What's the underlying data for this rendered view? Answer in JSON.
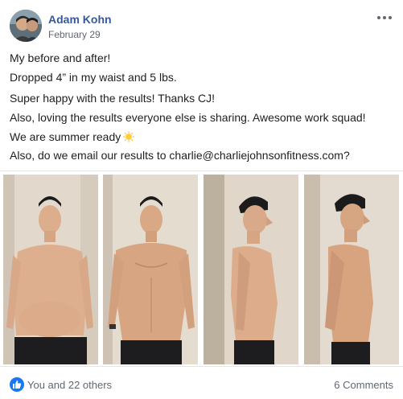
{
  "post": {
    "author": "Adam Kohn",
    "date": "February 29",
    "lines": [
      "My before and after!",
      "Dropped 4” in my waist and 5 lbs.",
      "Super happy with the results! Thanks CJ!",
      "Also, loving the results everyone else is sharing. Awesome work squad!",
      "We are summer ready",
      "Also, do we email our results to charlie@charliejohnsonfitness.com?"
    ],
    "emoji": "sun-emoji"
  },
  "photos": [
    {
      "label": "before-front"
    },
    {
      "label": "after-front"
    },
    {
      "label": "before-side"
    },
    {
      "label": "after-side"
    }
  ],
  "footer": {
    "reactions": "You and 22 others",
    "comments": "6 Comments"
  },
  "colors": {
    "author": "#385898",
    "like": "#1877f2",
    "muted": "#606770"
  }
}
